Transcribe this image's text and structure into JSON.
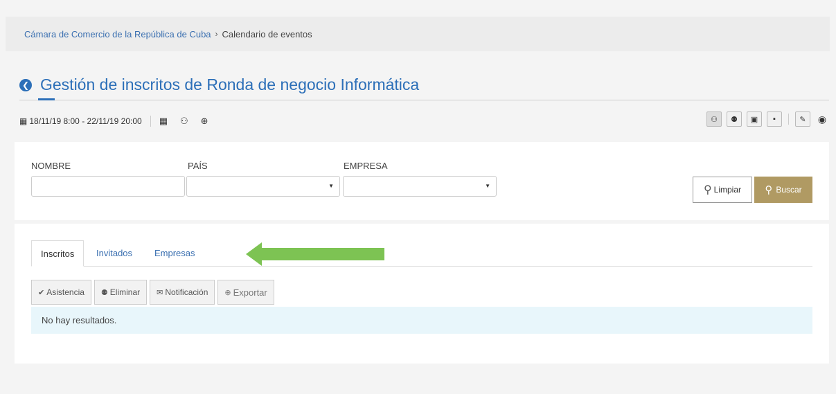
{
  "breadcrumb": {
    "parent": "Cámara de Comercio de la República de Cuba",
    "separator": "›",
    "current": "Calendario de eventos"
  },
  "header": {
    "title": "Gestión de inscritos de Ronda de negocio Informática",
    "back_icon": "arrow-left-circle-icon"
  },
  "meta": {
    "date_range": "18/11/19 8:00 - 22/11/19 20:00"
  },
  "filters": {
    "nombre_label": "NOMBRE",
    "pais_label": "PAÍS",
    "empresa_label": "EMPRESA",
    "nombre_value": "",
    "pais_value": "",
    "empresa_value": "",
    "clear_label": "Limpiar",
    "search_label": "Buscar"
  },
  "tabs": [
    {
      "label": "Inscritos",
      "active": true
    },
    {
      "label": "Invitados",
      "active": false
    },
    {
      "label": "Empresas",
      "active": false
    }
  ],
  "actions": {
    "asistencia": "Asistencia",
    "eliminar": "Eliminar",
    "notificacion": "Notificación",
    "exportar": "Exportar"
  },
  "results": {
    "empty_message": "No hay resultados."
  },
  "colors": {
    "primary": "#2c6fb8",
    "link": "#3a6fb0",
    "search_button": "#b09a63",
    "annotation_arrow": "#7dc353",
    "info_bg": "#e8f6fb"
  }
}
